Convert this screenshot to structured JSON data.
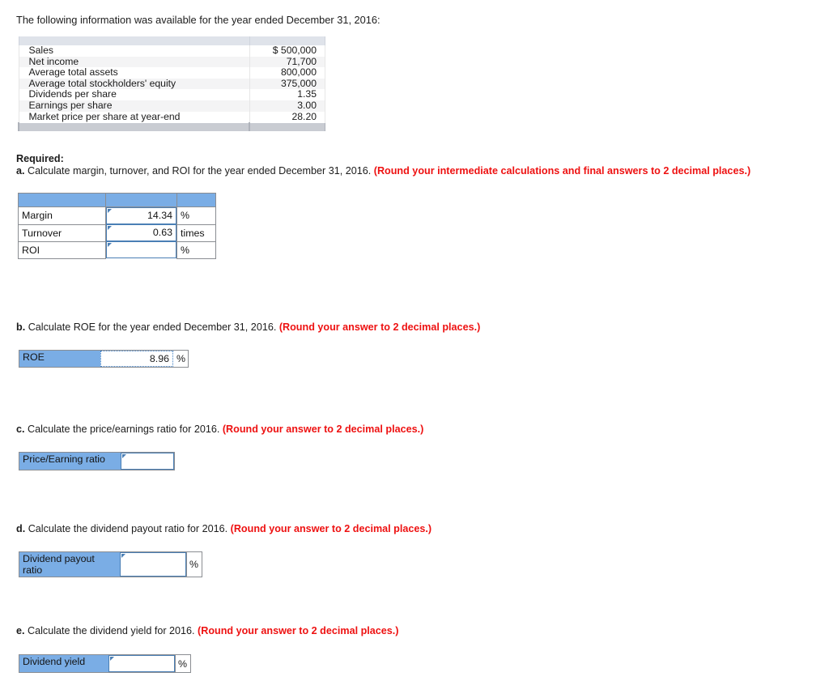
{
  "intro": "The following information was available for the year ended December 31, 2016:",
  "facts_table": {
    "rows": [
      {
        "label": "Sales",
        "value": "$ 500,000"
      },
      {
        "label": "Net income",
        "value": "71,700"
      },
      {
        "label": "Average total assets",
        "value": "800,000"
      },
      {
        "label": "Average total stockholders' equity",
        "value": "375,000"
      },
      {
        "label": "Dividends per share",
        "value": "1.35"
      },
      {
        "label": "Earnings per share",
        "value": "3.00"
      },
      {
        "label": "Market price per share at year-end",
        "value": "28.20"
      }
    ]
  },
  "required_heading": "Required:",
  "questions": {
    "a": {
      "letter": "a.",
      "text": " Calculate margin, turnover, and ROI for the year ended December 31, 2016. ",
      "note": "(Round your intermediate calculations and final answers to 2 decimal places.)"
    },
    "b": {
      "letter": "b.",
      "text": " Calculate ROE for the year ended December 31, 2016. ",
      "note": "(Round your answer to 2 decimal places.)"
    },
    "c": {
      "letter": "c.",
      "text": " Calculate the price/earnings ratio for 2016. ",
      "note": "(Round your answer to 2 decimal places.)"
    },
    "d": {
      "letter": "d.",
      "text": " Calculate the dividend payout ratio for 2016. ",
      "note": "(Round your answer to 2 decimal places.)"
    },
    "e": {
      "letter": "e.",
      "text": " Calculate the dividend yield for 2016. ",
      "note": "(Round your answer to 2 decimal places.)"
    }
  },
  "answer_a": {
    "rows": [
      {
        "label": "Margin",
        "value": "14.34",
        "unit": "%"
      },
      {
        "label": "Turnover",
        "value": "0.63",
        "unit": "times"
      },
      {
        "label": "ROI",
        "value": "",
        "unit": "%"
      }
    ]
  },
  "answer_b": {
    "label": "ROE",
    "value": "8.96",
    "unit": "%"
  },
  "answer_c": {
    "label": "Price/Earning ratio",
    "value": "",
    "unit": ""
  },
  "answer_d": {
    "label": "Dividend payout\nratio",
    "value": "",
    "unit": "%"
  },
  "answer_e": {
    "label": "Dividend yield",
    "value": "",
    "unit": "%"
  },
  "colors": {
    "header_blue": "#7aade5",
    "input_border_blue": "#4a7fb5",
    "note_red": "#ee1111",
    "facts_band": "#dfe3ea",
    "facts_footer": "#c9ccd2"
  }
}
